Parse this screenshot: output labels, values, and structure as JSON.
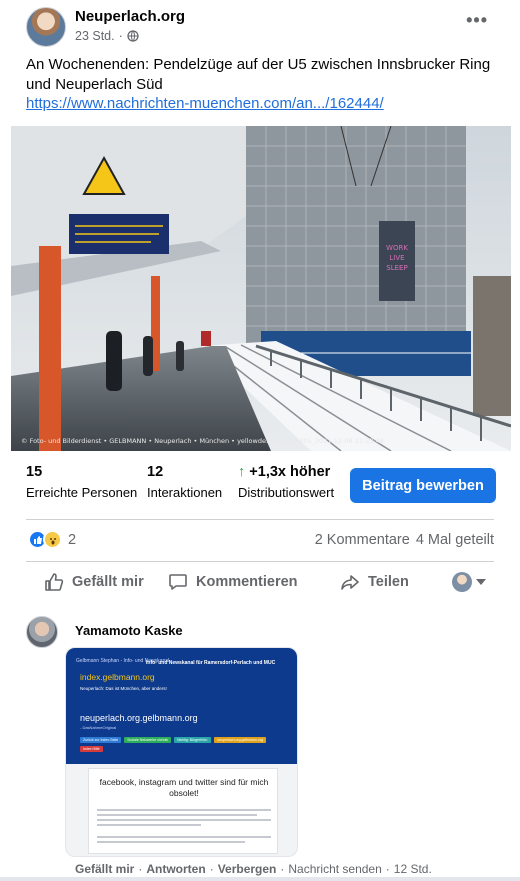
{
  "post": {
    "page_name": "Neuperlach.org",
    "time": "23 Std.",
    "separator": "·",
    "audience_icon": "globe-icon",
    "more_icon": "•••",
    "text": "An Wochenenden: Pendelzüge auf der U5 zwischen Innsbrucker Ring und Neuperlach Süd",
    "link": "https://www.nachrichten-muenchen.com/an.../162444/",
    "photo_credit": "© Foto- und Bilderdienst • GELBMANN • Neuperlach • München • yellowde.de _DSC3305_2021-12-08 11:33:48",
    "photo_banner": [
      "WORK",
      "LIVE",
      "SLEEP"
    ]
  },
  "insights": {
    "reached_value": "15",
    "reached_label": "Erreichte Personen",
    "interactions_value": "12",
    "interactions_label": "Interaktionen",
    "distribution_arrow": "↑",
    "distribution_value": "+1,3x höher",
    "distribution_label": "Distributionswert",
    "promote_label": "Beitrag bewerben"
  },
  "engagement": {
    "reaction_count": "2",
    "comments": "2 Kommentare",
    "shares": "4 Mal geteilt"
  },
  "actions": {
    "like": "Gefällt mir",
    "comment": "Kommentieren",
    "share": "Teilen"
  },
  "comment": {
    "author": "Yamamoto Kaske",
    "image": {
      "header_small": "Gelbmann Stephan - Info- und Newskanal",
      "news_title": "Info- und Newskanal für Ramersdorf-Perlach und MUC",
      "site": "index.gelbmann.org",
      "sub": "Neuperlach: Das ist München, aber anders!",
      "main": "neuperlach.org.gelbmann.org",
      "tag": "- DasNahmeOriginal",
      "buttons": [
        "Zurück zur Index-Seite",
        "Soziale Netzwerke sIchnik",
        "Nichtig: Bürgerfrühr.",
        "neuperlach.org.gelbmann.org",
        "Index Hilfe"
      ],
      "panel_title": "facebook, instagram und twitter sind für mich obsolet!"
    },
    "footer_like": "Gefällt mir",
    "footer_reply": "Antworten",
    "footer_hide": "Verbergen",
    "footer_message": "Nachricht senden",
    "footer_time": "12 Std.",
    "dot": "·"
  }
}
